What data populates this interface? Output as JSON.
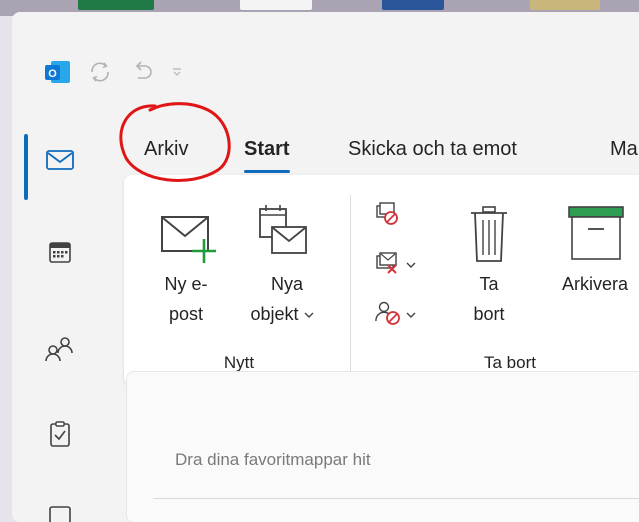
{
  "colors": {
    "accent": "#0f6cbd",
    "outlook_blue": "#0f78d4",
    "annotation_red": "#e01616",
    "new_plus_green": "#1e9b3b",
    "archive_green": "#2e9e53",
    "delete_red": "#d13438"
  },
  "quick_access": {
    "icons": [
      "outlook-logo",
      "sync-icon",
      "undo-icon",
      "customize-dropdown-icon"
    ]
  },
  "left_rail": {
    "items": [
      {
        "name": "mail",
        "icon": "mail-icon",
        "active": true
      },
      {
        "name": "calendar",
        "icon": "calendar-icon",
        "active": false
      },
      {
        "name": "people",
        "icon": "people-icon",
        "active": false
      },
      {
        "name": "tasks",
        "icon": "tasks-icon",
        "active": false
      },
      {
        "name": "more",
        "icon": "more-icon",
        "active": false
      }
    ]
  },
  "tabs": [
    {
      "label": "Arkiv"
    },
    {
      "label": "Start",
      "active": true
    },
    {
      "label": "Skicka och ta emot"
    },
    {
      "label": "Ma"
    }
  ],
  "ribbon": {
    "groups": {
      "new": {
        "label": "Nytt",
        "new_email": {
          "line1": "Ny e-",
          "line2": "post",
          "icon": "new-mail-icon"
        },
        "new_items": {
          "line1": "Nya",
          "line2": "objekt",
          "icon": "new-items-icon",
          "dropdown_icon": "chevron-down-icon"
        }
      },
      "delete": {
        "label": "Ta bort",
        "ignore": {
          "icon": "ignore-icon"
        },
        "clean_up": {
          "icon": "clean-up-icon",
          "dropdown_icon": "chevron-down-icon"
        },
        "junk": {
          "icon": "junk-icon",
          "dropdown_icon": "chevron-down-icon"
        },
        "delete_button": {
          "line1": "Ta",
          "line2": "bort",
          "icon": "trash-icon"
        },
        "archive_button": {
          "label": "Arkivera",
          "icon": "archive-icon"
        }
      }
    }
  },
  "folder_pane": {
    "favorites_placeholder": "Dra dina favoritmappar hit"
  },
  "annotation": {
    "shape": "hand-drawn-ellipse",
    "target": "Arkiv",
    "color": "#e01616"
  }
}
